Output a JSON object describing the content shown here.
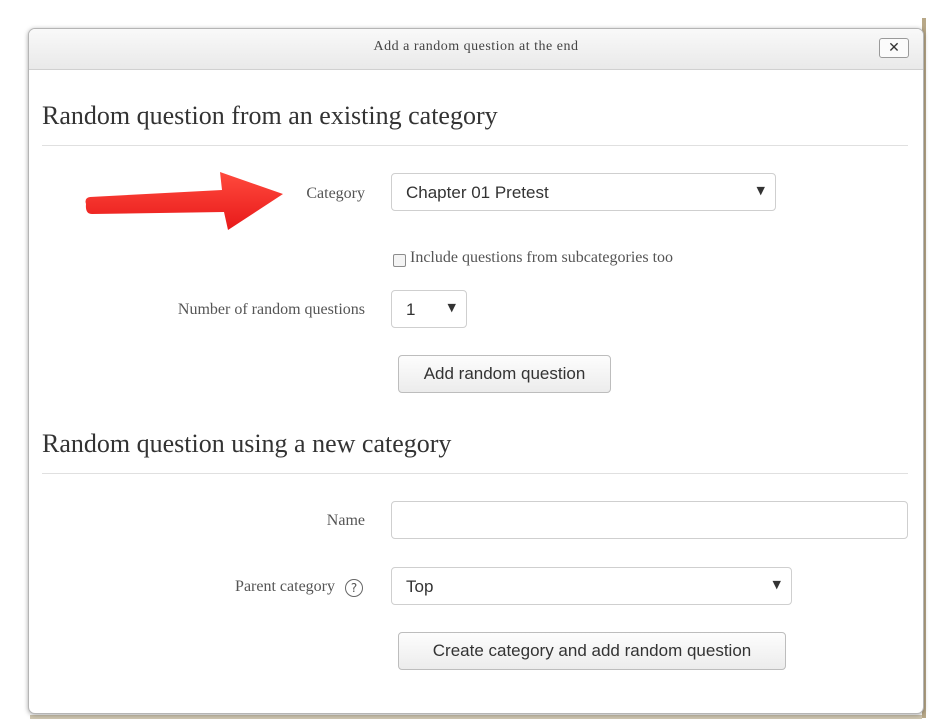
{
  "dialog": {
    "title": "Add a random question at the end",
    "close_glyph": "✕"
  },
  "existing": {
    "heading": "Random question from an existing category",
    "category_label": "Category",
    "category_value": "Chapter 01 Pretest",
    "include_subcategories_label": "Include questions from subcategories too",
    "include_subcategories_checked": false,
    "number_label": "Number of random questions",
    "number_value": "1",
    "add_button": "Add random question"
  },
  "new_category": {
    "heading": "Random question using a new category",
    "name_label": "Name",
    "name_value": "",
    "parent_label": "Parent category",
    "parent_value": "Top",
    "help_glyph": "?",
    "create_button": "Create category and add random question"
  },
  "icons": {
    "select_caret": "▼",
    "annotation_arrow_color": "#e8191a"
  }
}
